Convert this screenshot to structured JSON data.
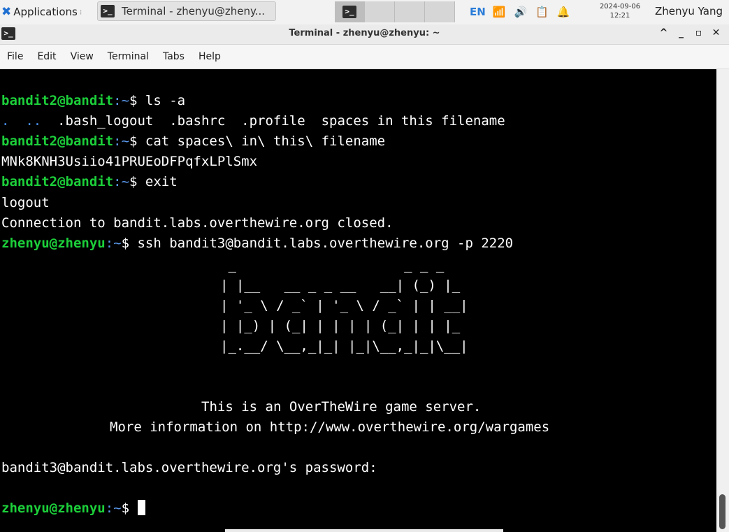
{
  "panel": {
    "apps_label": "Applications",
    "task_label": "Terminal - zhenyu@zheny...",
    "lang": "EN",
    "clock_date": "2024-09-06",
    "clock_time": "12:21",
    "user": "Zhenyu Yang",
    "icons": [
      "xfce-icon",
      "terminal-icon",
      "network-icon",
      "volume-icon",
      "clipboard-icon",
      "bell-icon"
    ]
  },
  "window": {
    "title": "Terminal - zhenyu@zhenyu: ~",
    "controls": {
      "up": "^",
      "min": "_",
      "max": "▫",
      "close": "✕"
    },
    "menus": [
      "File",
      "Edit",
      "View",
      "Terminal",
      "Tabs",
      "Help"
    ]
  },
  "terminal": {
    "lines": [
      {
        "user": "bandit2@bandit",
        "path": ":~",
        "cmd": "$ ls -a"
      },
      {
        "ls_dots": ".  ..",
        "ls_rest": "  .bash_logout  .bashrc  .profile  spaces in this filename"
      },
      {
        "user": "bandit2@bandit",
        "path": ":~",
        "cmd": "$ cat spaces\\ in\\ this\\ filename"
      },
      {
        "text": "MNk8KNH3Usiio41PRUEoDFPqfxLPlSmx"
      },
      {
        "user": "bandit2@bandit",
        "path": ":~",
        "cmd": "$ exit"
      },
      {
        "text": "logout"
      },
      {
        "text": "Connection to bandit.labs.overthewire.org closed."
      },
      {
        "user": "zhenyu@zhenyu",
        "path": ":~",
        "cmd": "$ ssh bandit3@bandit.labs.overthewire.org -p 2220"
      }
    ],
    "banner": [
      " _                     _ _ _  ",
      "| |__   __ _ _ __   __| (_) |_ ",
      "| '_ \\ / _` | '_ \\ / _` | | __|",
      "| |_) | (_| | | | | (_| | | |_ ",
      "|_.__/ \\__,_|_| |_|\\__,_|_|\\__|"
    ],
    "info1": "This is an OverTheWire game server.",
    "info2": "More information on http://www.overthewire.org/wargames",
    "password_prompt": "bandit3@bandit.labs.overthewire.org's password:",
    "final_prompt": {
      "user": "zhenyu@zhenyu",
      "path": ":~",
      "cmd": "$ "
    }
  }
}
